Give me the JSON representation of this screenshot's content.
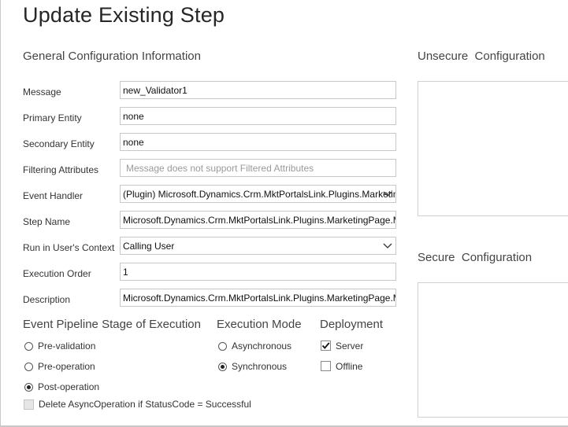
{
  "title": "Update Existing Step",
  "general": {
    "heading": "General Configuration Information",
    "fields": [
      {
        "label": "Message",
        "value": "new_Validator1"
      },
      {
        "label": "Primary Entity",
        "value": "none"
      },
      {
        "label": "Secondary Entity",
        "value": "none"
      },
      {
        "label": "Filtering Attributes",
        "placeholder": "Message does not support Filtered Attributes"
      },
      {
        "label": "Event Handler",
        "value": "(Plugin) Microsoft.Dynamics.Crm.MktPortalsLink.Plugins.MarketingPage"
      },
      {
        "label": "Step Name",
        "value": "Microsoft.Dynamics.Crm.MktPortalsLink.Plugins.MarketingPage.MarketingPage"
      },
      {
        "label": "Run in User's Context",
        "value": "Calling User"
      },
      {
        "label": "Execution Order",
        "value": "1"
      },
      {
        "label": "Description",
        "value": "Microsoft.Dynamics.Crm.MktPortalsLink.Plugins.MarketingPage.MarketingPage"
      }
    ]
  },
  "pipeline": {
    "heading": "Event Pipeline Stage of Execution",
    "options": [
      {
        "label": "Pre-validation",
        "selected": false
      },
      {
        "label": "Pre-operation",
        "selected": false
      },
      {
        "label": "Post-operation",
        "selected": true
      }
    ],
    "delete_async_label": "Delete AsyncOperation if StatusCode = Successful",
    "delete_async_checked": false
  },
  "execution_mode": {
    "heading": "Execution Mode",
    "options": [
      {
        "label": "Asynchronous",
        "selected": false
      },
      {
        "label": "Synchronous",
        "selected": true
      }
    ]
  },
  "deployment": {
    "heading": "Deployment",
    "options": [
      {
        "label": "Server",
        "checked": true
      },
      {
        "label": "Offline",
        "checked": false
      }
    ]
  },
  "unsecure_config": {
    "heading": "Unsecure  Configuration",
    "value": ""
  },
  "secure_config": {
    "heading": "Secure  Configuration",
    "value": ""
  },
  "icons": {
    "dropdown": "chevron-down-icon",
    "checkmark": "checkmark-icon"
  }
}
